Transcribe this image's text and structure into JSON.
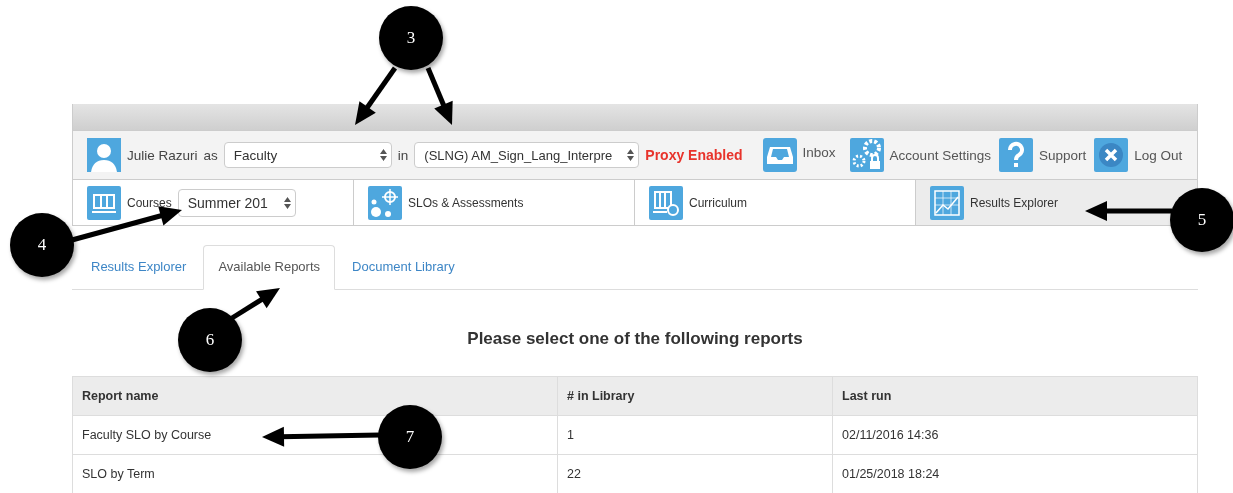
{
  "user_bar": {
    "user_name": "Julie Razuri",
    "as_label": "as",
    "role_select": "Faculty",
    "in_label": "in",
    "course_select": "(SLNG) AM_Sign_Lang_Interpre",
    "proxy_status": "Proxy Enabled",
    "links": [
      {
        "kind": "inbox",
        "label": "Inbox"
      },
      {
        "kind": "settings",
        "label": "Account Settings"
      },
      {
        "kind": "support",
        "label": "Support"
      },
      {
        "kind": "logout",
        "label": "Log Out"
      }
    ]
  },
  "nav_tabs": [
    {
      "kind": "courses",
      "label": "Courses",
      "term_select": "Summer 201",
      "selected": false
    },
    {
      "kind": "slos",
      "label": "SLOs & Assessments",
      "selected": false
    },
    {
      "kind": "curriculum",
      "label": "Curriculum",
      "selected": false
    },
    {
      "kind": "results",
      "label": "Results Explorer",
      "selected": true
    }
  ],
  "sub_tabs": [
    {
      "label": "Results Explorer",
      "selected": false
    },
    {
      "label": "Available Reports",
      "selected": true
    },
    {
      "label": "Document Library",
      "selected": false
    }
  ],
  "heading": "Please select one of the following reports",
  "table": {
    "columns": [
      "Report name",
      "# in Library",
      "Last run"
    ],
    "rows": [
      [
        "Faculty SLO by Course",
        "1",
        "02/11/2016 14:36"
      ],
      [
        "SLO by Term",
        "22",
        "01/25/2018 18:24"
      ]
    ]
  },
  "callouts": [
    {
      "label": "3"
    },
    {
      "label": "4"
    },
    {
      "label": "5"
    },
    {
      "label": "6"
    },
    {
      "label": "7"
    }
  ]
}
